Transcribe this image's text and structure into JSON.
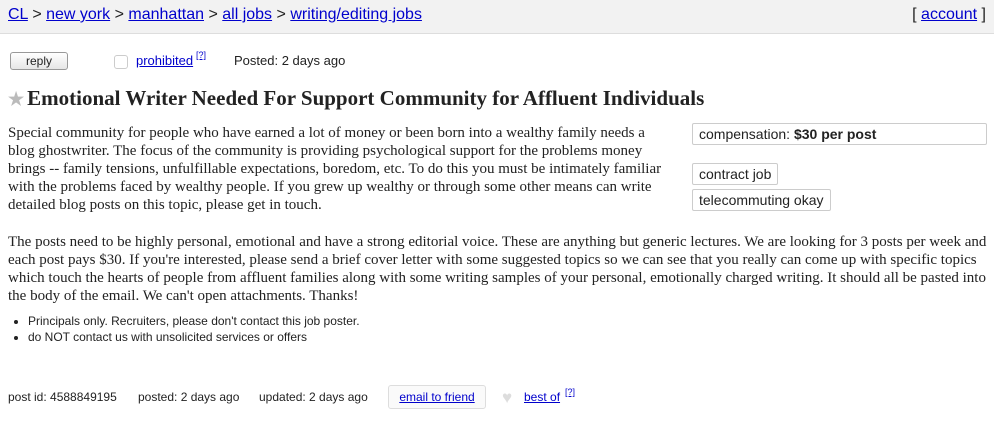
{
  "breadcrumb": {
    "items": [
      "CL",
      "new york",
      "manhattan",
      "all jobs",
      "writing/editing jobs"
    ],
    "separator": ">",
    "account": "account",
    "bracket_open": "[",
    "bracket_close": "]"
  },
  "actions": {
    "reply": "reply",
    "prohibited": "prohibited",
    "prohibited_sup": "[?]",
    "posted": "Posted: 2 days ago"
  },
  "posting": {
    "title": "Emotional Writer Needed For Support Community for Affluent Individuals",
    "para1": "Special community for people who have earned a lot of money or been born into a wealthy family needs a blog ghostwriter. The focus of the community is providing psychological support for the problems money brings -- family tensions, unfulfillable expectations, boredom, etc. To do this you must be intimately familiar with the problems faced by wealthy people. If you grew up wealthy or through some other means can write detailed blog posts on this topic, please get in touch.",
    "para2": "The posts need to be highly personal, emotional and have a strong editorial voice. These are anything but generic lectures. We are looking for 3 posts per week and each post pays $30. If you're interested, please send a brief cover letter with some suggested topics so we can see that you really can come up with specific topics which touch the hearts of people from affluent families along with some writing samples of your personal, emotionally charged writing. It should all be pasted into the body of the email. We can't open attachments. Thanks!"
  },
  "attributes": {
    "compensation_label": "compensation:",
    "compensation_value": "$30 per post",
    "job_type": "contract job",
    "telecommute": "telecommuting okay"
  },
  "notices": [
    "Principals only. Recruiters, please don't contact this job poster.",
    "do NOT contact us with unsolicited services or offers"
  ],
  "footer": {
    "post_id": "post id: 4588849195",
    "posted": "posted: 2 days ago",
    "updated": "updated: 2 days ago",
    "email_friend": "email to friend",
    "best_of": "best of",
    "best_of_sup": "[?]"
  }
}
